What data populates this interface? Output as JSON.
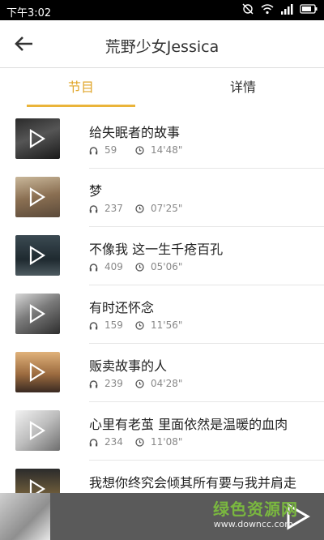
{
  "status_bar": {
    "time": "下午3:02",
    "icons": [
      "alarm-off-icon",
      "wifi-icon",
      "signal-icon",
      "battery-icon"
    ]
  },
  "header": {
    "title": "荒野少女Jessica",
    "back_icon": "arrow-left-icon"
  },
  "tabs": [
    {
      "label": "节目",
      "active": true
    },
    {
      "label": "详情",
      "active": false
    }
  ],
  "episodes": [
    {
      "title": "给失眠者的故事",
      "plays": "59",
      "duration": "14'48\""
    },
    {
      "title": "梦",
      "plays": "237",
      "duration": "07'25\""
    },
    {
      "title": "不像我 这一生千疮百孔",
      "plays": "409",
      "duration": "05'06\""
    },
    {
      "title": "有时还怀念",
      "plays": "159",
      "duration": "11'56\""
    },
    {
      "title": "贩卖故事的人",
      "plays": "239",
      "duration": "04'28\""
    },
    {
      "title": "心里有老茧 里面依然是温暖的血肉",
      "plays": "234",
      "duration": "11'08\""
    },
    {
      "title": "我想你终究会倾其所有要与我并肩走",
      "plays": "",
      "duration": ""
    }
  ],
  "watermark": {
    "text": "绿色资源网",
    "url": "www.downcc.com"
  },
  "colors": {
    "accent": "#eab43a",
    "status_bar": "#000000",
    "player_bar": "#5a5a5a"
  }
}
